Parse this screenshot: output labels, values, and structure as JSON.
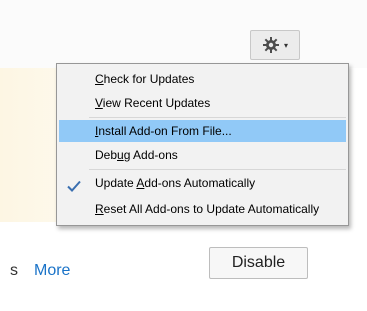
{
  "tools_button": {
    "icon": "gear-icon",
    "dropdown_icon": "chevron-down-icon"
  },
  "menu": {
    "items": [
      {
        "before": "",
        "accel": "C",
        "after": "heck for Updates",
        "checked": false,
        "highlighted": false
      },
      {
        "before": "",
        "accel": "V",
        "after": "iew Recent Updates",
        "checked": false,
        "highlighted": false
      },
      {
        "before": "",
        "accel": "I",
        "after": "nstall Add-on From File...",
        "checked": false,
        "highlighted": true
      },
      {
        "before": "Deb",
        "accel": "u",
        "after": "g Add-ons",
        "checked": false,
        "highlighted": false
      },
      {
        "before": "Update ",
        "accel": "A",
        "after": "dd-ons Automatically",
        "checked": true,
        "highlighted": false
      },
      {
        "before": "",
        "accel": "R",
        "after": "eset All Add-ons to Update Automatically",
        "checked": false,
        "highlighted": false
      }
    ]
  },
  "footer": {
    "prefix_text": "s",
    "more_link": "More",
    "disable_button": "Disable"
  },
  "colors": {
    "highlight": "#91c9f7",
    "link": "#1a73c8",
    "menu_bg": "#f2f2f2"
  }
}
